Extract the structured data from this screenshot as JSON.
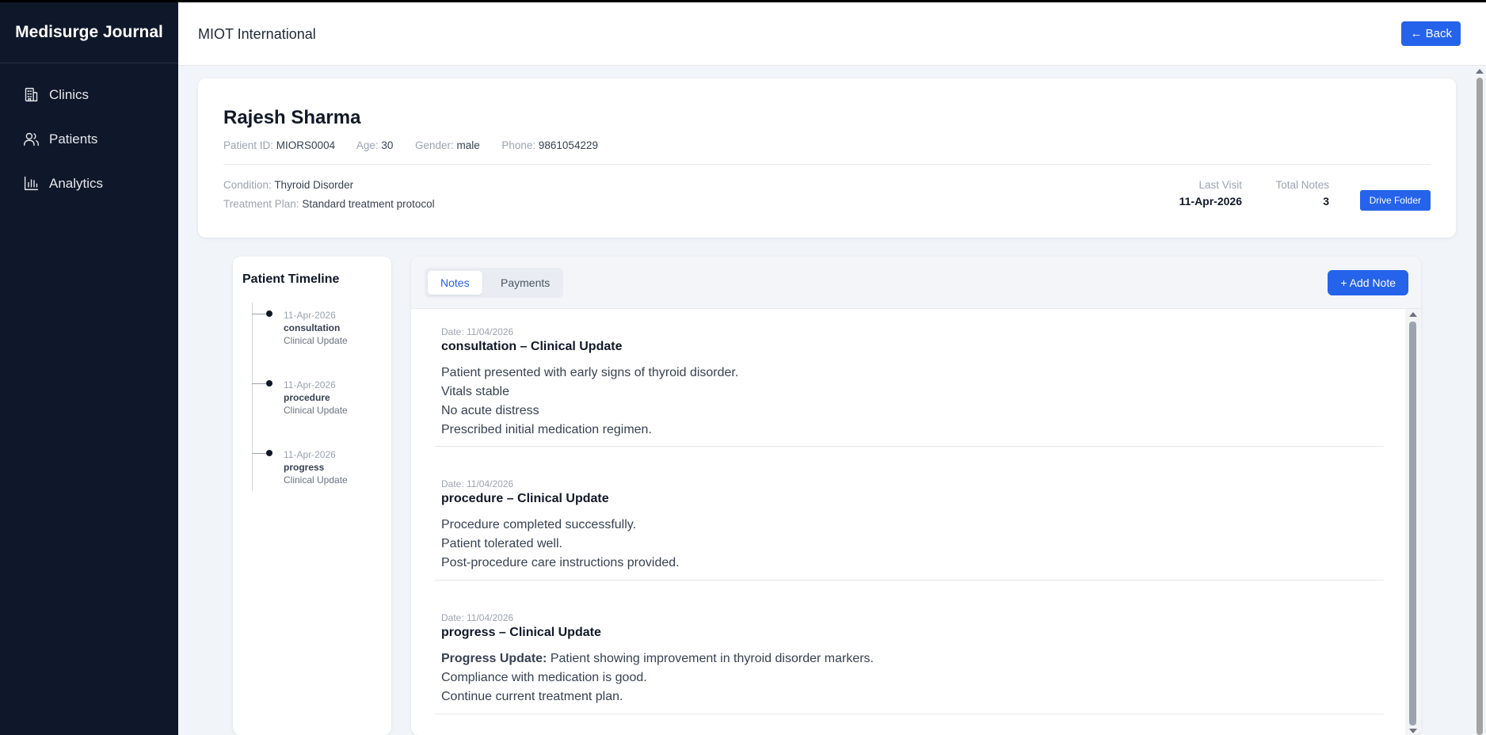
{
  "app": {
    "brand": "Medisurge Journal"
  },
  "sidebar": {
    "items": [
      {
        "label": "Clinics",
        "icon": "building-icon"
      },
      {
        "label": "Patients",
        "icon": "users-icon"
      },
      {
        "label": "Analytics",
        "icon": "bar-chart-icon"
      }
    ]
  },
  "header": {
    "title": "MIOT International",
    "back_label": "← Back"
  },
  "patient": {
    "name": "Rajesh Sharma",
    "id_label": "Patient ID:",
    "id": "MIORS0004",
    "age_label": "Age:",
    "age": "30",
    "gender_label": "Gender:",
    "gender": "male",
    "phone_label": "Phone:",
    "phone": "9861054229",
    "condition_label": "Condition:",
    "condition": "Thyroid Disorder",
    "plan_label": "Treatment Plan:",
    "plan": "Standard treatment protocol",
    "last_visit_label": "Last Visit",
    "last_visit": "11-Apr-2026",
    "total_notes_label": "Total Notes",
    "total_notes": "3",
    "drive_label": "Drive Folder"
  },
  "timeline": {
    "title": "Patient Timeline",
    "items": [
      {
        "date": "11-Apr-2026",
        "type": "consultation",
        "sub": "Clinical Update"
      },
      {
        "date": "11-Apr-2026",
        "type": "procedure",
        "sub": "Clinical Update"
      },
      {
        "date": "11-Apr-2026",
        "type": "progress",
        "sub": "Clinical Update"
      }
    ]
  },
  "notes_panel": {
    "tabs": [
      {
        "label": "Notes",
        "active": true
      },
      {
        "label": "Payments",
        "active": false
      }
    ],
    "add_label": "+ Add Note",
    "notes": [
      {
        "date": "Date: 11/04/2026",
        "title": "consultation – Clinical Update",
        "lines": [
          "Patient presented with early signs of thyroid disorder.",
          "Vitals stable",
          "No acute distress",
          "Prescribed initial medication regimen."
        ]
      },
      {
        "date": "Date: 11/04/2026",
        "title": "procedure – Clinical Update",
        "lines": [
          "Procedure completed successfully.",
          "Patient tolerated well.",
          "Post-procedure care instructions provided."
        ]
      },
      {
        "date": "Date: 11/04/2026",
        "title": "progress – Clinical Update",
        "lead_bold": "Progress Update:",
        "lines": [
          "Patient showing improvement in thyroid disorder markers.",
          "Compliance with medication is good.",
          "Continue current treatment plan."
        ]
      }
    ]
  },
  "colors": {
    "sidebar_bg": "#0f172a",
    "accent": "#2563eb",
    "page_bg": "#f1f4f9"
  }
}
